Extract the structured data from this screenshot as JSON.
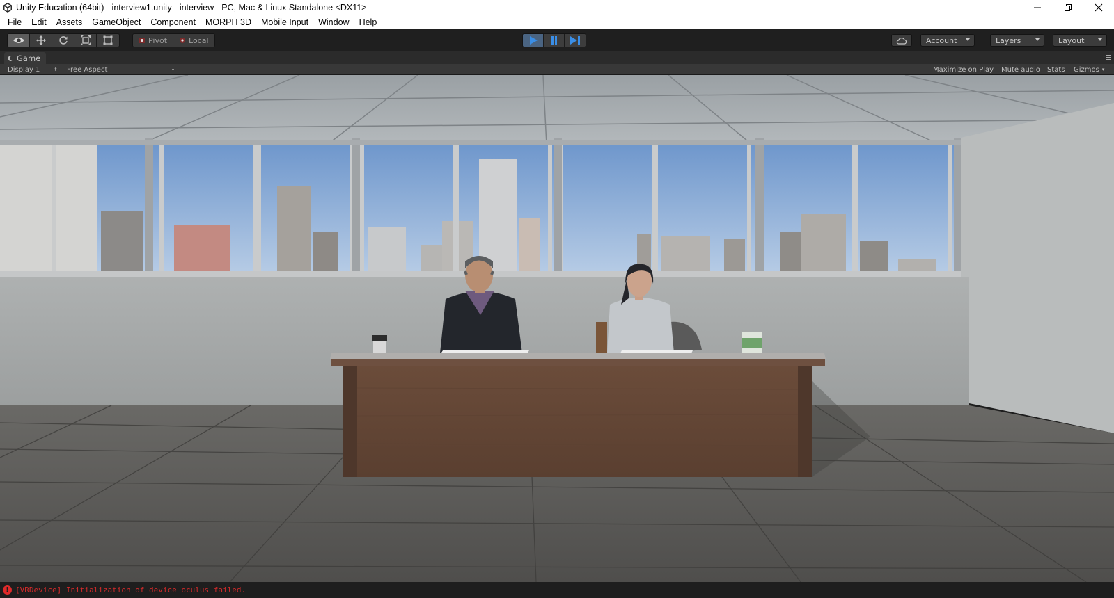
{
  "window": {
    "title": "Unity Education (64bit) - interview1.unity - interview - PC, Mac & Linux Standalone <DX11>"
  },
  "menu": [
    "File",
    "Edit",
    "Assets",
    "GameObject",
    "Component",
    "MORPH 3D",
    "Mobile Input",
    "Window",
    "Help"
  ],
  "toolbar": {
    "pivot_label": "Pivot",
    "local_label": "Local",
    "account_label": "Account",
    "layers_label": "Layers",
    "layout_label": "Layout",
    "play_state": "playing"
  },
  "game_panel": {
    "tab_label": "Game",
    "display_label": "Display 1",
    "aspect_label": "Free Aspect",
    "maximize_label": "Maximize on Play",
    "mute_label": "Mute audio",
    "stats_label": "Stats",
    "gizmos_label": "Gizmos"
  },
  "status": {
    "message": "[VRDevice] Initialization of device oculus failed."
  },
  "colors": {
    "play_blue": "#3a8ee6",
    "error_red": "#d22a2a",
    "toolbar_bg": "#1f1f1f"
  },
  "icons": [
    "unity-logo-icon",
    "minimize-icon",
    "restore-icon",
    "close-icon",
    "view-tool-icon",
    "move-tool-icon",
    "rotate-tool-icon",
    "scale-tool-icon",
    "rect-tool-icon",
    "play-icon",
    "pause-icon",
    "step-icon",
    "cloud-icon",
    "game-tab-icon",
    "panel-menu-icon",
    "error-icon"
  ]
}
